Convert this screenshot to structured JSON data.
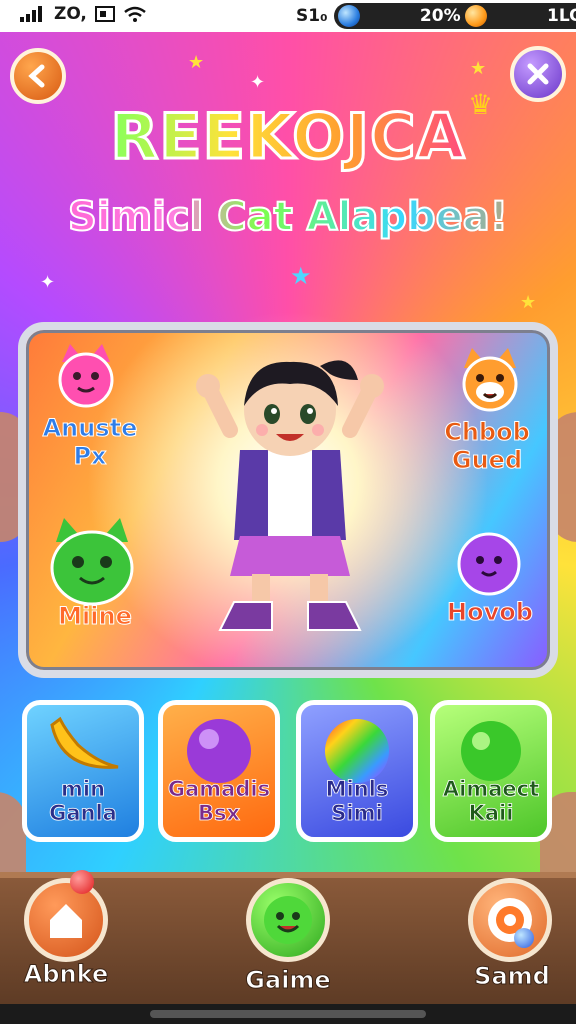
{
  "status_bar": {
    "left_text": "ZO,",
    "battery_label": "S1₀",
    "percent": "20%",
    "count": "1LO"
  },
  "title": {
    "main": "REEKOJCA",
    "sub": "Simicl Cat Alapbea!"
  },
  "panel": {
    "mascots": [
      {
        "label_1": "Anuste",
        "label_2": "Px",
        "color": "#ff4fb0",
        "icon": "pink-cat-icon"
      },
      {
        "label_1": "Chbob",
        "label_2": "Gued",
        "color": "#ff9d2f",
        "icon": "orange-cat-icon"
      },
      {
        "label_1": "Miine",
        "label_2": "",
        "color": "#3cc43a",
        "icon": "green-cat-icon"
      },
      {
        "label_1": "Hovob",
        "label_2": "",
        "color": "#a646e8",
        "icon": "purple-blob-icon"
      }
    ]
  },
  "cards": [
    {
      "label_1": "min",
      "label_2": "Ganla",
      "bg": "#2fa8ff",
      "icon": "banana-icon"
    },
    {
      "label_1": "Gamadis",
      "label_2": "Bsx",
      "bg": "#ff8a1a",
      "icon": "purple-ball-icon"
    },
    {
      "label_1": "Minls",
      "label_2": "Simi",
      "bg": "#5a6dff",
      "icon": "rainbow-ball-icon"
    },
    {
      "label_1": "Aimaect",
      "label_2": "Kaii",
      "bg": "#6fd640",
      "icon": "green-ball-icon"
    }
  ],
  "nav": {
    "home_label": "Abnke",
    "game_label": "Gaime",
    "sound_label": "Samd"
  },
  "colors": {
    "accent_orange": "#d85a12",
    "accent_purple": "#6a36c9",
    "wood": "#6a4128"
  }
}
